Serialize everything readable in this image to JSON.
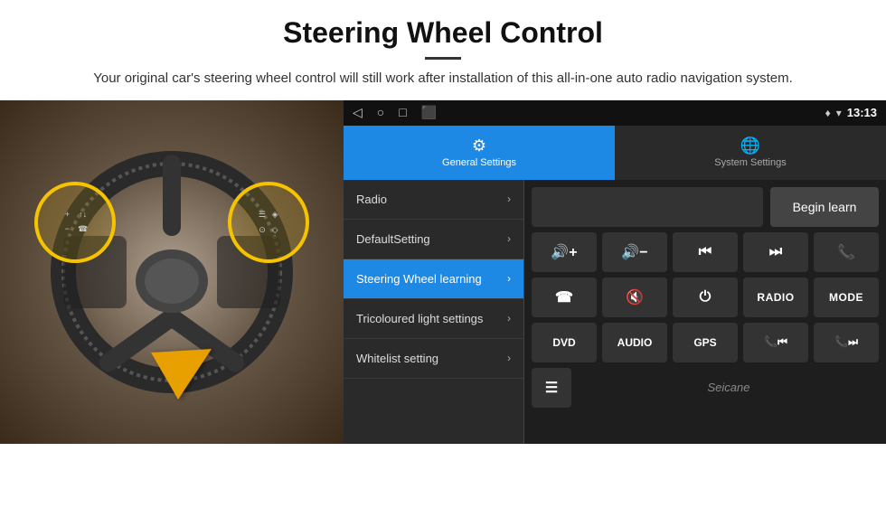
{
  "header": {
    "title": "Steering Wheel Control",
    "subtitle": "Your original car's steering wheel control will still work after installation of this all-in-one auto radio navigation system."
  },
  "status_bar": {
    "nav_icons": [
      "◁",
      "○",
      "□",
      "⬛"
    ],
    "right_icons": "♦ ▾",
    "time": "13:13"
  },
  "tabs": {
    "general": {
      "label": "General Settings",
      "icon": "⚙"
    },
    "system": {
      "label": "System Settings",
      "icon": "🌐"
    }
  },
  "menu": {
    "items": [
      {
        "label": "Radio",
        "active": false
      },
      {
        "label": "DefaultSetting",
        "active": false
      },
      {
        "label": "Steering Wheel learning",
        "active": true
      },
      {
        "label": "Tricoloured light settings",
        "active": false
      },
      {
        "label": "Whitelist setting",
        "active": false
      }
    ]
  },
  "right_panel": {
    "begin_learn_label": "Begin learn",
    "controls": {
      "row1": [
        {
          "label": "🔊+",
          "type": "icon"
        },
        {
          "label": "🔊−",
          "type": "icon"
        },
        {
          "label": "⏮",
          "type": "icon"
        },
        {
          "label": "⏭",
          "type": "icon"
        },
        {
          "label": "📞",
          "type": "icon"
        }
      ],
      "row2": [
        {
          "label": "☎",
          "type": "icon"
        },
        {
          "label": "🔇",
          "type": "icon"
        },
        {
          "label": "⏻",
          "type": "icon"
        },
        {
          "label": "RADIO",
          "type": "text"
        },
        {
          "label": "MODE",
          "type": "text"
        }
      ],
      "row3": [
        {
          "label": "DVD",
          "type": "text"
        },
        {
          "label": "AUDIO",
          "type": "text"
        },
        {
          "label": "GPS",
          "type": "text"
        },
        {
          "label": "📞⏮",
          "type": "icon"
        },
        {
          "label": "📞⏭",
          "type": "icon"
        }
      ]
    },
    "bottom_icon": "☰",
    "watermark": "Seicane"
  }
}
